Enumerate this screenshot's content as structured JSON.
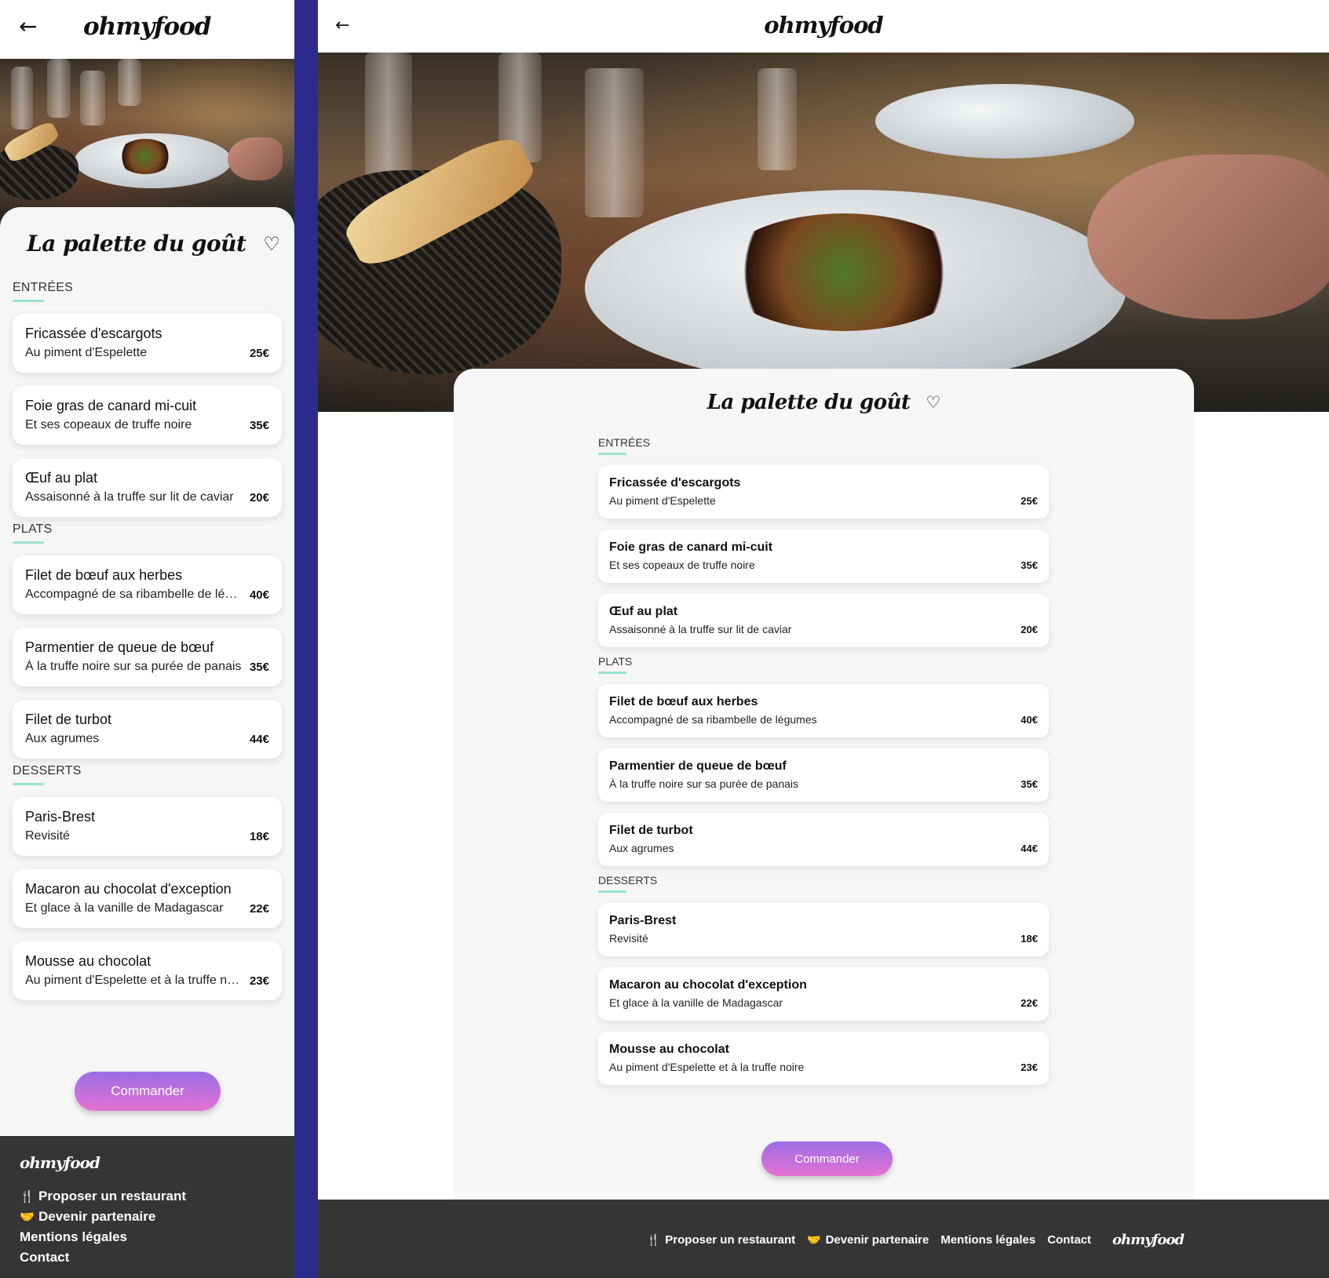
{
  "brand": "ohmyfood",
  "restaurant": "La palette du goût",
  "sections": [
    {
      "title": "ENTRÉES",
      "items": [
        {
          "name": "Fricassée d'escargots",
          "desc": "Au piment d'Espelette",
          "price": "25€"
        },
        {
          "name": "Foie gras de canard mi-cuit",
          "desc": "Et ses copeaux de truffe noire",
          "price": "35€"
        },
        {
          "name": "Œuf au plat",
          "desc": "Assaisonné à la truffe sur lit de caviar",
          "price": "20€"
        }
      ]
    },
    {
      "title": "PLATS",
      "items": [
        {
          "name": "Filet de bœuf aux herbes",
          "desc": "Accompagné de sa ribambelle de légumes",
          "price": "40€"
        },
        {
          "name": "Parmentier de queue de bœuf",
          "desc": "À la truffe noire sur sa purée de panais",
          "price": "35€"
        },
        {
          "name": "Filet de turbot",
          "desc": "Aux agrumes",
          "price": "44€"
        }
      ]
    },
    {
      "title": "DESSERTS",
      "items": [
        {
          "name": "Paris-Brest",
          "desc": "Revisité",
          "price": "18€"
        },
        {
          "name": "Macaron au chocolat d'exception",
          "desc": "Et glace à la vanille de Madagascar",
          "price": "22€"
        },
        {
          "name": "Mousse au chocolat",
          "desc": "Au piment d'Espelette et à la truffe noire",
          "price": "23€"
        }
      ]
    }
  ],
  "order_button": "Commander",
  "footer": {
    "links": [
      {
        "label": "Proposer un restaurant",
        "icon": "utensils-icon"
      },
      {
        "label": "Devenir partenaire",
        "icon": "handshake-icon"
      },
      {
        "label": "Mentions légales",
        "icon": ""
      },
      {
        "label": "Contact",
        "icon": ""
      }
    ]
  },
  "colors": {
    "accent_line": "#99e2d0",
    "button_gradient_top": "#9b6de6",
    "button_gradient_bottom": "#e472d3",
    "footer_bg": "#353535",
    "card_bg": "#f6f6f6",
    "divider": "#2b2b8e"
  },
  "icons": {
    "back": "arrow-left-icon",
    "favorite": "heart-outline-icon"
  }
}
